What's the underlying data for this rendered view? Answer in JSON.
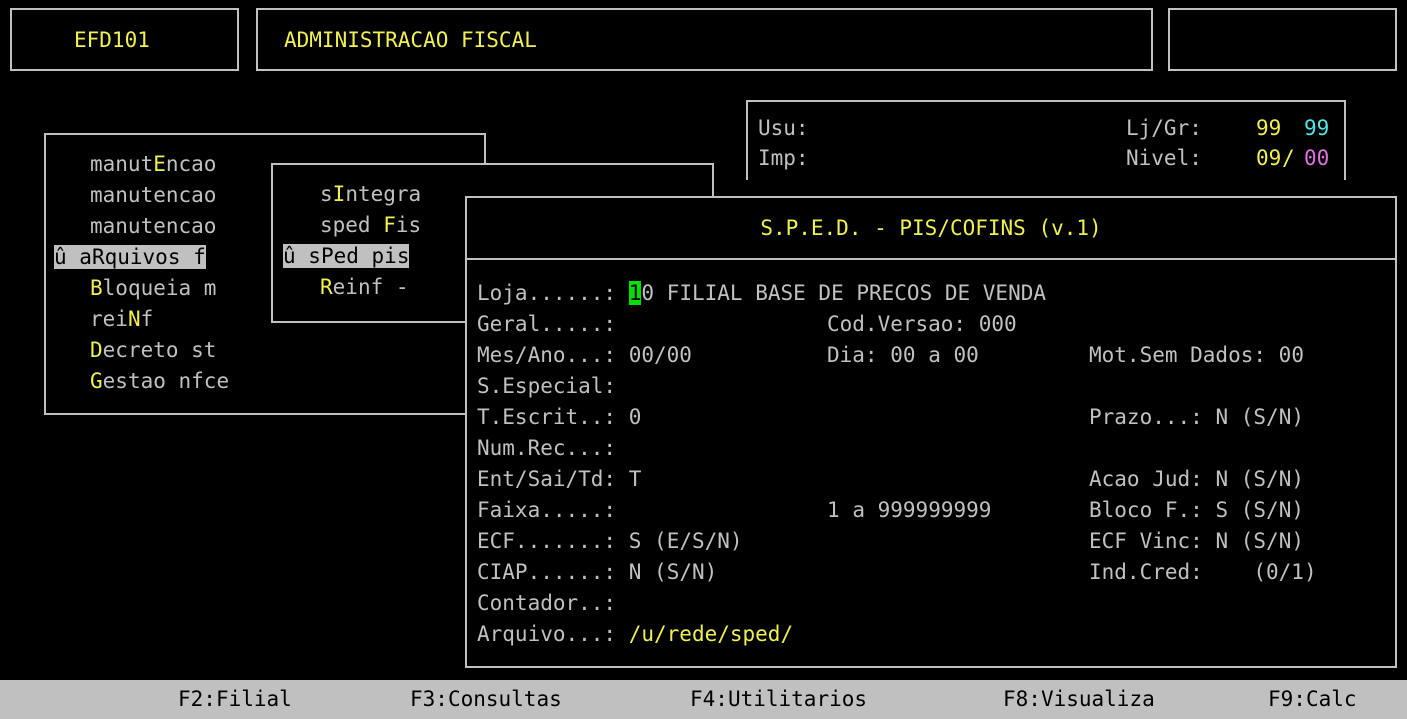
{
  "header": {
    "program_code": "EFD101",
    "title": "ADMINISTRACAO FISCAL",
    "right_box": ""
  },
  "info": {
    "usu_label": "Usu:",
    "usu_value": "",
    "imp_label": "Imp:",
    "imp_value": "",
    "ljgr_label": "Lj/Gr:",
    "ljgr_loja": "99",
    "ljgr_grupo": "99",
    "nivel_label": "Nivel:",
    "nivel_a": "09",
    "nivel_sep": "/",
    "nivel_b": "00"
  },
  "menu1": {
    "items": [
      {
        "pre": "",
        "hot": "manut",
        "key": "E",
        "post": "ncao"
      },
      {
        "pre": "",
        "hot": "manutencao",
        "key": "",
        "post": ""
      },
      {
        "pre": "",
        "hot": "manutencao",
        "key": "",
        "post": ""
      },
      {
        "pre": "û ",
        "hot": "a",
        "key": "R",
        "post": "quivos f"
      },
      {
        "pre": "",
        "hot": "",
        "key": "B",
        "post": "loqueia m"
      },
      {
        "pre": "",
        "hot": "rei",
        "key": "N",
        "post": "f"
      },
      {
        "pre": "",
        "hot": "",
        "key": "D",
        "post": "ecreto st"
      },
      {
        "pre": "",
        "hot": "",
        "key": "G",
        "post": "estao nfce"
      }
    ]
  },
  "menu2": {
    "items": [
      {
        "pre": "",
        "hot": "s",
        "key": "I",
        "post": "ntegra"
      },
      {
        "pre": "",
        "hot": "sped ",
        "key": "F",
        "post": "is"
      },
      {
        "pre": "û ",
        "hot": "s",
        "key": "P",
        "post": "ed pis"
      },
      {
        "pre": "",
        "hot": "",
        "key": "R",
        "post": "einf -"
      }
    ]
  },
  "dialog": {
    "title": "S.P.E.D. - PIS/COFINS (v.1)",
    "loja_label": "Loja......:",
    "loja_cursor": "1",
    "loja_rest": "0",
    "loja_name": "FILIAL BASE DE PRECOS DE VENDA",
    "geral_label": "Geral.....:",
    "cod_versao_label": "Cod.Versao:",
    "cod_versao_value": "000",
    "mesano_label": "Mes/Ano...:",
    "mesano_value": "00/00",
    "dia_label": "Dia:",
    "dia_from": "00",
    "dia_a": "a",
    "dia_to": "00",
    "motsem_label": "Mot.Sem Dados:",
    "motsem_value": "00",
    "sespecial_label": "S.Especial:",
    "tescrit_label": "T.Escrit..:",
    "tescrit_value": "0",
    "prazo_label": "Prazo...:",
    "prazo_value": "N",
    "prazo_opts": "(S/N)",
    "numrec_label": "Num.Rec...:",
    "entsai_label": "Ent/Sai/Td:",
    "entsai_value": "T",
    "acaojud_label": "Acao Jud:",
    "acaojud_value": "N",
    "acaojud_opts": "(S/N)",
    "faixa_label": "Faixa.....:",
    "faixa_from": "1",
    "faixa_a": "a",
    "faixa_to": "999999999",
    "blocof_label": "Bloco F.:",
    "blocof_value": "S",
    "blocof_opts": "(S/N)",
    "ecf_label": "ECF.......:",
    "ecf_value": "S",
    "ecf_opts": "(E/S/N)",
    "ecfvinc_label": "ECF Vinc:",
    "ecfvinc_value": "N",
    "ecfvinc_opts": "(S/N)",
    "ciap_label": "CIAP......:",
    "ciap_value": "N",
    "ciap_opts": "(S/N)",
    "indcred_label": "Ind.Cred:",
    "indcred_opts": "(0/1)",
    "contador_label": "Contador..:",
    "arquivo_label": "Arquivo...:",
    "arquivo_value": "/u/rede/sped/"
  },
  "function_keys": [
    {
      "key": "F2:",
      "label": "Filial"
    },
    {
      "key": "F3:",
      "label": "Consultas"
    },
    {
      "key": "F4:",
      "label": "Utilitarios"
    },
    {
      "key": "F8:",
      "label": "Visualiza"
    },
    {
      "key": "F9:",
      "label": "Calc"
    }
  ]
}
